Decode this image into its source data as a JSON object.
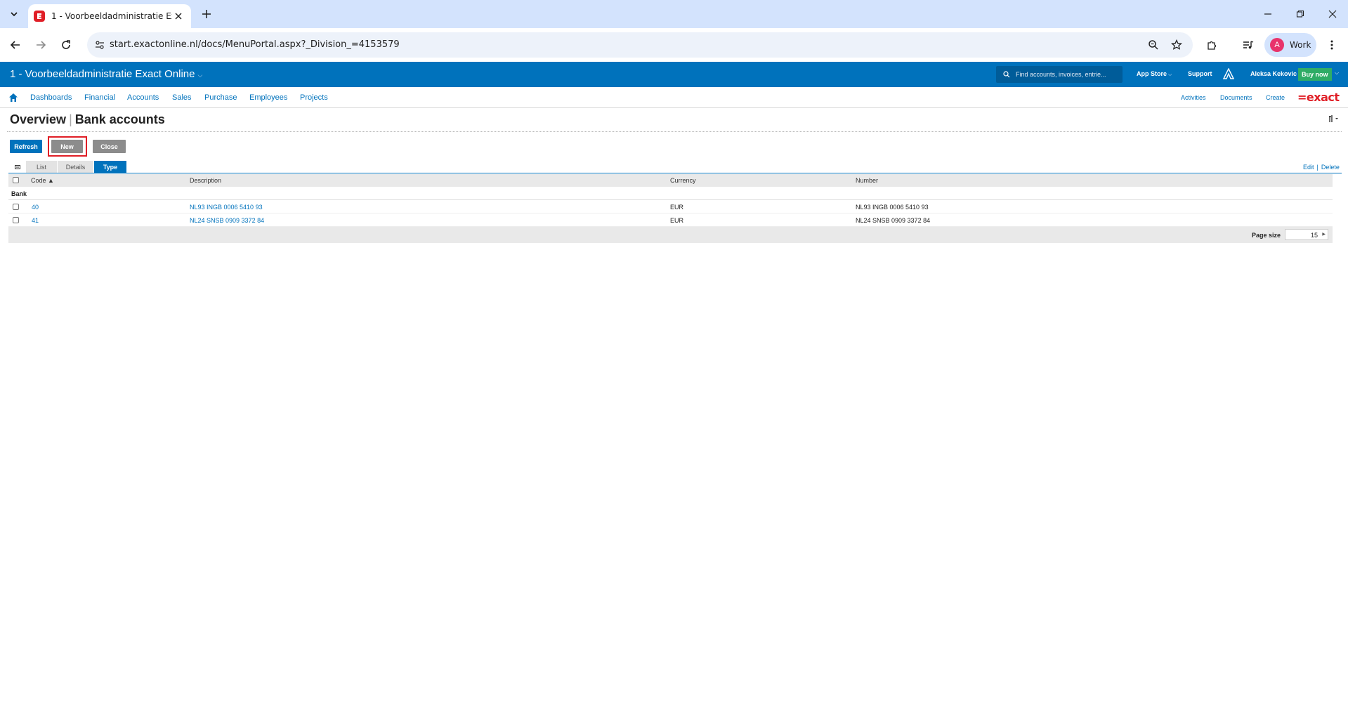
{
  "browser": {
    "tab_title": "1 - Voorbeeldadministratie Exact Online",
    "url": "start.exactonline.nl/docs/MenuPortal.aspx?_Division_=4153579",
    "profile_initial": "A",
    "profile_name": "Work"
  },
  "header": {
    "division_title": "1 - Voorbeeldadministratie Exact Online",
    "search_placeholder": "Find accounts, invoices, entrie...",
    "app_store": "App Store",
    "support": "Support",
    "user_name": "Aleksa Kekovic",
    "buy_now": "Buy now"
  },
  "menu": {
    "items": [
      "Dashboards",
      "Financial",
      "Accounts",
      "Sales",
      "Purchase",
      "Employees",
      "Projects"
    ],
    "right_items": [
      "Activities",
      "Documents",
      "Create"
    ],
    "logo": "=exact"
  },
  "page": {
    "title_main": "Overview",
    "title_sub": "Bank accounts"
  },
  "actions": {
    "refresh": "Refresh",
    "new": "New",
    "close": "Close"
  },
  "view_tabs": [
    "List",
    "Details",
    "Type"
  ],
  "grid_actions": {
    "edit": "Edit",
    "delete": "Delete"
  },
  "grid": {
    "columns": [
      "Code ▲",
      "Description",
      "Currency",
      "Number"
    ],
    "group": "Bank",
    "rows": [
      {
        "code": "40",
        "description": "NL93 INGB 0006 5410 93",
        "currency": "EUR",
        "number": "NL93 INGB 0006 5410 93"
      },
      {
        "code": "41",
        "description": "NL24 SNSB 0909 3372 84",
        "currency": "EUR",
        "number": "NL24 SNSB 0909 3372 84"
      }
    ],
    "page_size_label": "Page size",
    "page_size": "15"
  },
  "colors": {
    "brand_blue": "#0072bc",
    "exact_red": "#e01e26",
    "buy_green": "#2fac66"
  }
}
